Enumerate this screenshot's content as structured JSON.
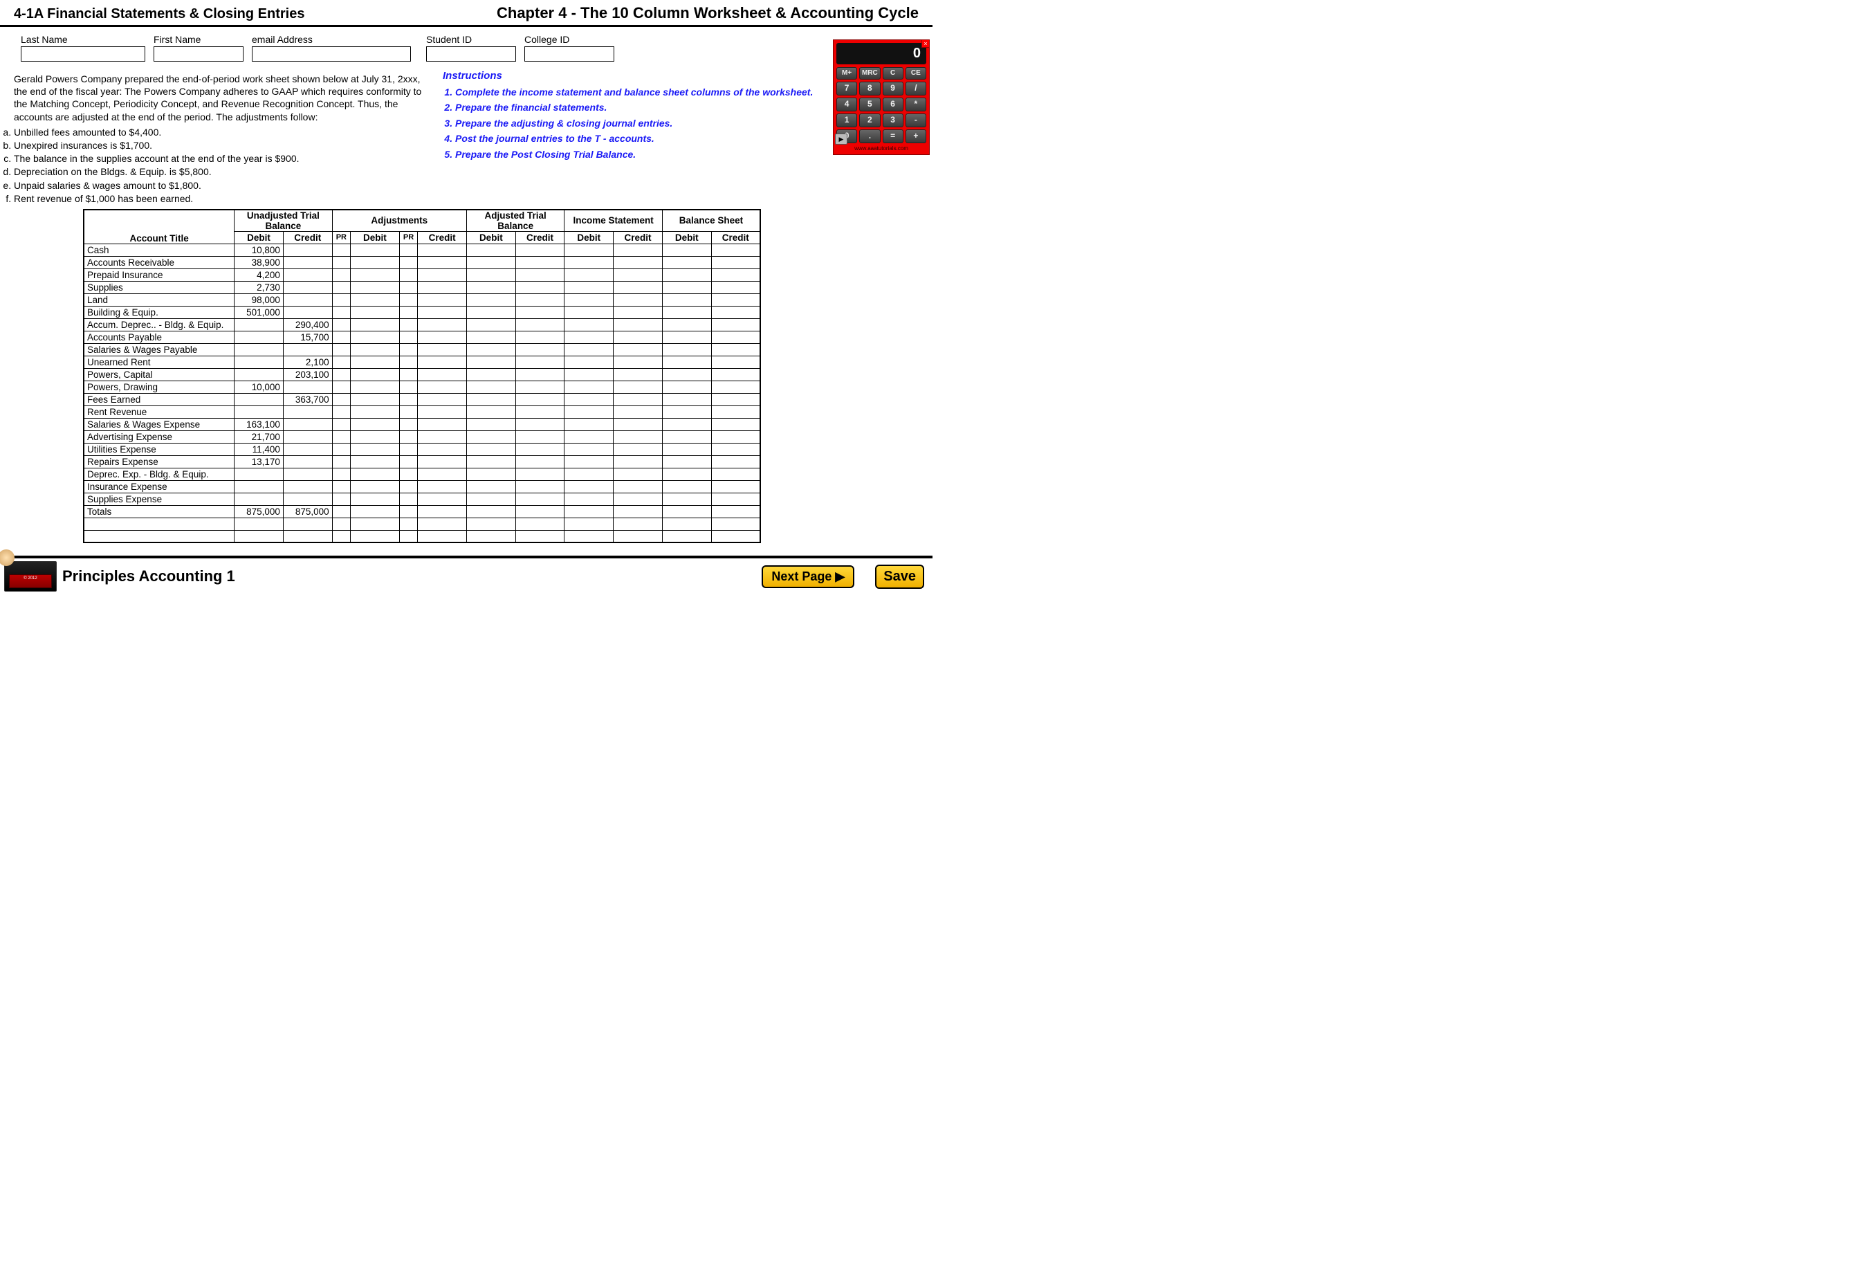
{
  "header": {
    "left": "4-1A  Financial Statements & Closing Entries",
    "right": "Chapter 4 - The 10 Column Worksheet & Accounting Cycle"
  },
  "form": {
    "last_name": {
      "label": "Last Name",
      "value": ""
    },
    "first_name": {
      "label": "First Name",
      "value": ""
    },
    "email": {
      "label": "email Address",
      "value": ""
    },
    "student_id": {
      "label": "Student ID",
      "value": ""
    },
    "college_id": {
      "label": "College ID",
      "value": ""
    }
  },
  "problem_text": "Gerald Powers Company prepared the end-of-period work sheet shown below at July 31, 2xxx, the end of the fiscal year:  The Powers Company adheres to GAAP which requires conformity to the Matching Concept, Periodicity Concept, and Revenue Recognition Concept.  Thus, the accounts are adjusted at the end of the period.  The adjustments follow:",
  "adjustments": [
    "Unbilled fees amounted to $4,400.",
    "Unexpired insurances is $1,700.",
    "The balance in the supplies account at the end of the year is $900.",
    "Depreciation on the Bldgs. & Equip. is $5,800.",
    "Unpaid salaries & wages amount to $1,800.",
    "Rent revenue of $1,000 has been earned."
  ],
  "instructions": {
    "title": "Instructions",
    "items": [
      "Complete the income statement and balance sheet columns of the worksheet.",
      "Prepare the financial statements.",
      "Prepare the adjusting & closing journal entries.",
      "Post the journal entries to the T - accounts.",
      "Prepare the Post Closing Trial Balance."
    ]
  },
  "calculator": {
    "display": "0",
    "row_mem": [
      "M+",
      "MRC",
      "C",
      "CE"
    ],
    "rows": [
      [
        "7",
        "8",
        "9",
        "/"
      ],
      [
        "4",
        "5",
        "6",
        "*"
      ],
      [
        "1",
        "2",
        "3",
        "-"
      ],
      [
        "0",
        ".",
        "=",
        "+"
      ]
    ],
    "link": "www.aaatutorials.com"
  },
  "worksheet": {
    "group_headers": [
      "Unadjusted Trial Balance",
      "Adjustments",
      "Adjusted Trial Balance",
      "Income Statement",
      "Balance Sheet"
    ],
    "sub_headers": {
      "title": "Account Title",
      "debit": "Debit",
      "credit": "Credit",
      "pr": "PR"
    },
    "rows": [
      {
        "title": "Cash",
        "utb_d": "10,800",
        "utb_c": ""
      },
      {
        "title": "Accounts Receivable",
        "utb_d": "38,900",
        "utb_c": ""
      },
      {
        "title": "Prepaid Insurance",
        "utb_d": "4,200",
        "utb_c": ""
      },
      {
        "title": "Supplies",
        "utb_d": "2,730",
        "utb_c": ""
      },
      {
        "title": "Land",
        "utb_d": "98,000",
        "utb_c": ""
      },
      {
        "title": "Building & Equip.",
        "utb_d": "501,000",
        "utb_c": ""
      },
      {
        "title": "Accum. Deprec.. - Bldg. & Equip.",
        "utb_d": "",
        "utb_c": "290,400"
      },
      {
        "title": "Accounts Payable",
        "utb_d": "",
        "utb_c": "15,700"
      },
      {
        "title": "Salaries & Wages Payable",
        "utb_d": "",
        "utb_c": ""
      },
      {
        "title": "Unearned Rent",
        "utb_d": "",
        "utb_c": "2,100"
      },
      {
        "title": "Powers, Capital",
        "utb_d": "",
        "utb_c": "203,100"
      },
      {
        "title": "Powers, Drawing",
        "utb_d": "10,000",
        "utb_c": ""
      },
      {
        "title": "Fees Earned",
        "utb_d": "",
        "utb_c": "363,700"
      },
      {
        "title": "Rent Revenue",
        "utb_d": "",
        "utb_c": ""
      },
      {
        "title": "Salaries & Wages Expense",
        "utb_d": "163,100",
        "utb_c": ""
      },
      {
        "title": "Advertising Expense",
        "utb_d": "21,700",
        "utb_c": ""
      },
      {
        "title": "Utilities Expense",
        "utb_d": "11,400",
        "utb_c": ""
      },
      {
        "title": "Repairs Expense",
        "utb_d": "13,170",
        "utb_c": ""
      },
      {
        "title": "Deprec. Exp. - Bldg. & Equip.",
        "utb_d": "",
        "utb_c": ""
      },
      {
        "title": "Insurance Expense",
        "utb_d": "",
        "utb_c": ""
      },
      {
        "title": "Supplies Expense",
        "utb_d": "",
        "utb_c": ""
      },
      {
        "title": "Totals",
        "utb_d": "875,000",
        "utb_c": "875,000"
      }
    ]
  },
  "footer": {
    "title": "Principles Accounting 1",
    "logo_year": "© 2012",
    "next": "Next Page ▶",
    "save": "Save"
  }
}
